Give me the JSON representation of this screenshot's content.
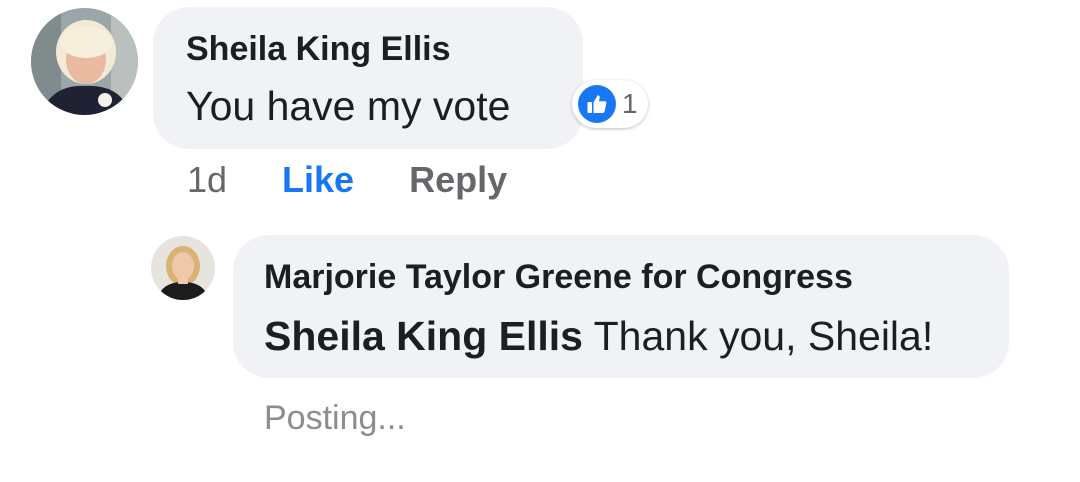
{
  "comment": {
    "author": "Sheila King Ellis",
    "text": "You have my vote",
    "reaction": {
      "icon": "thumbs-up-icon",
      "count": "1",
      "color": "#1877f2"
    },
    "meta": {
      "time": "1d",
      "like_label": "Like",
      "reply_label": "Reply"
    }
  },
  "reply": {
    "author": "Marjorie Taylor Greene for Congress",
    "mention": "Sheila King Ellis",
    "text": "Thank you, Sheila!",
    "status": "Posting..."
  },
  "colors": {
    "bubble_bg": "#f0f2f5",
    "primary_text": "#1c1e21",
    "secondary_text": "#65676b",
    "accent": "#1877f2"
  }
}
